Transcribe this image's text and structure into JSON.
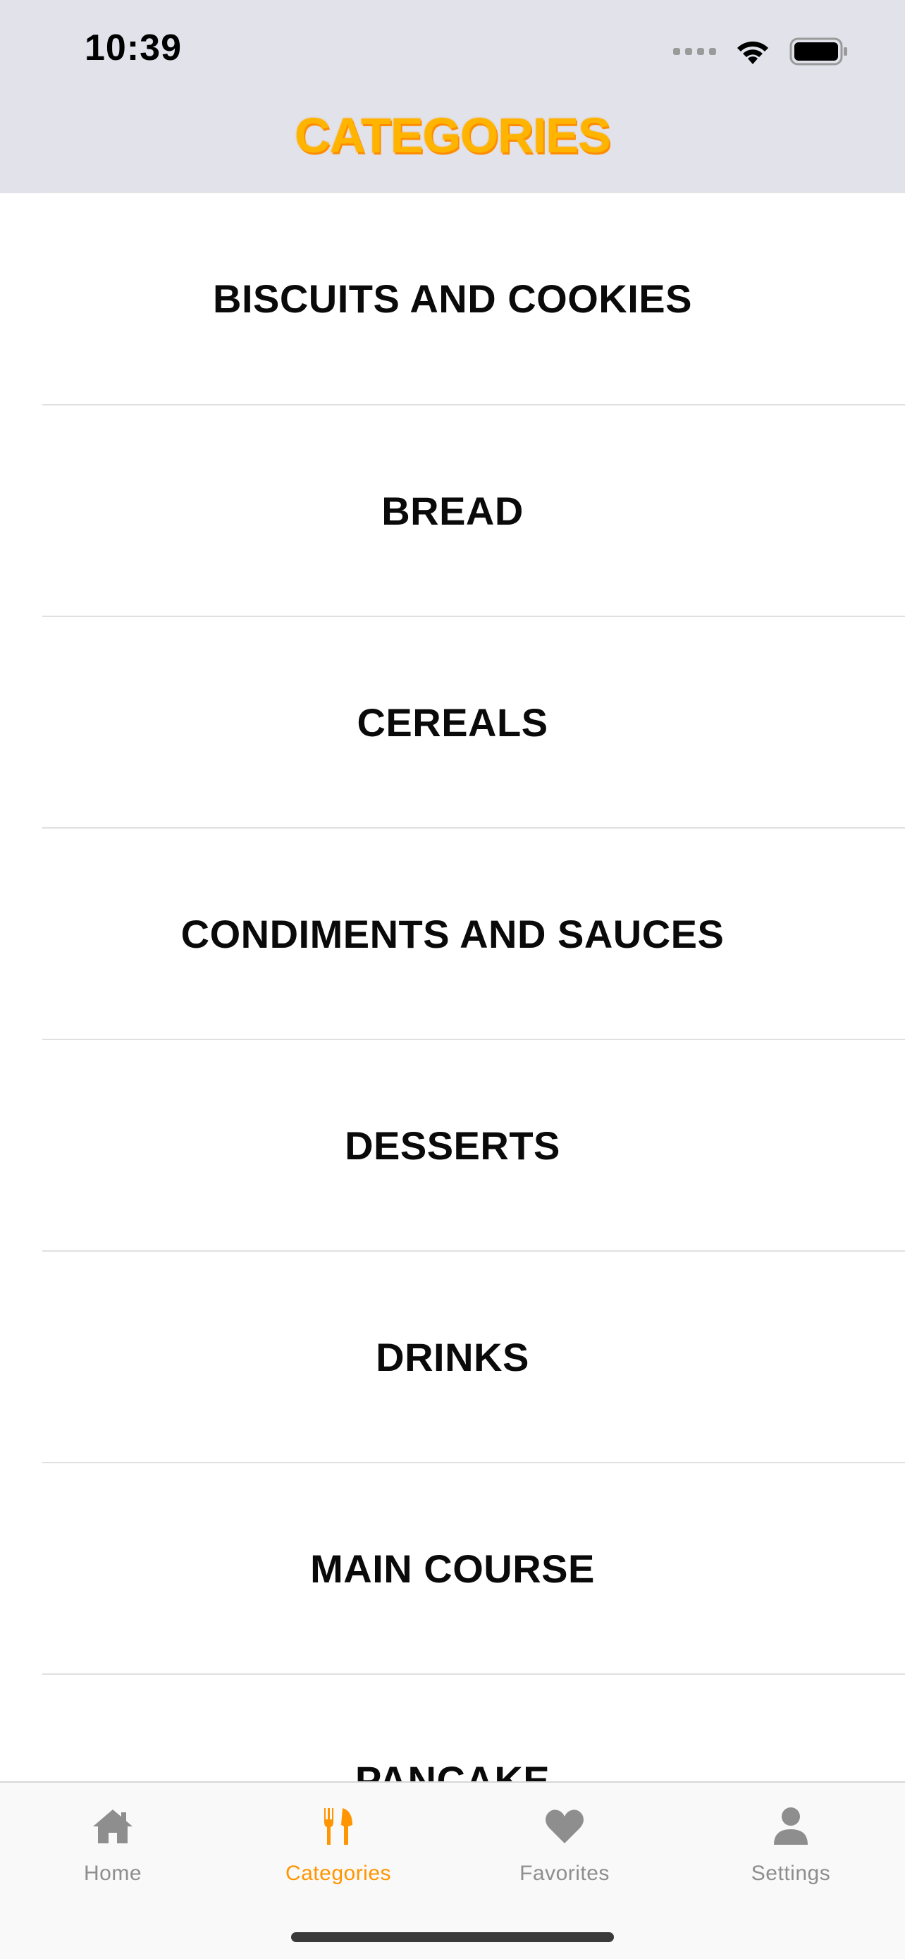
{
  "status_bar": {
    "time": "10:39"
  },
  "header": {
    "title": "CATEGORIES"
  },
  "categories": [
    "BISCUITS AND COOKIES",
    "BREAD",
    "CEREALS",
    "CONDIMENTS AND SAUCES",
    "DESSERTS",
    "DRINKS",
    "MAIN COURSE",
    "PANCAKE"
  ],
  "tabs": [
    {
      "label": "Home",
      "icon": "home-icon",
      "active": false
    },
    {
      "label": "Categories",
      "icon": "fork-knife-icon",
      "active": true
    },
    {
      "label": "Favorites",
      "icon": "heart-icon",
      "active": false
    },
    {
      "label": "Settings",
      "icon": "person-icon",
      "active": false
    }
  ],
  "colors": {
    "accent": "#ff9500",
    "title": "#ffb400",
    "header_bg": "#e1e2ea",
    "tab_inactive": "#8e8e8e"
  }
}
